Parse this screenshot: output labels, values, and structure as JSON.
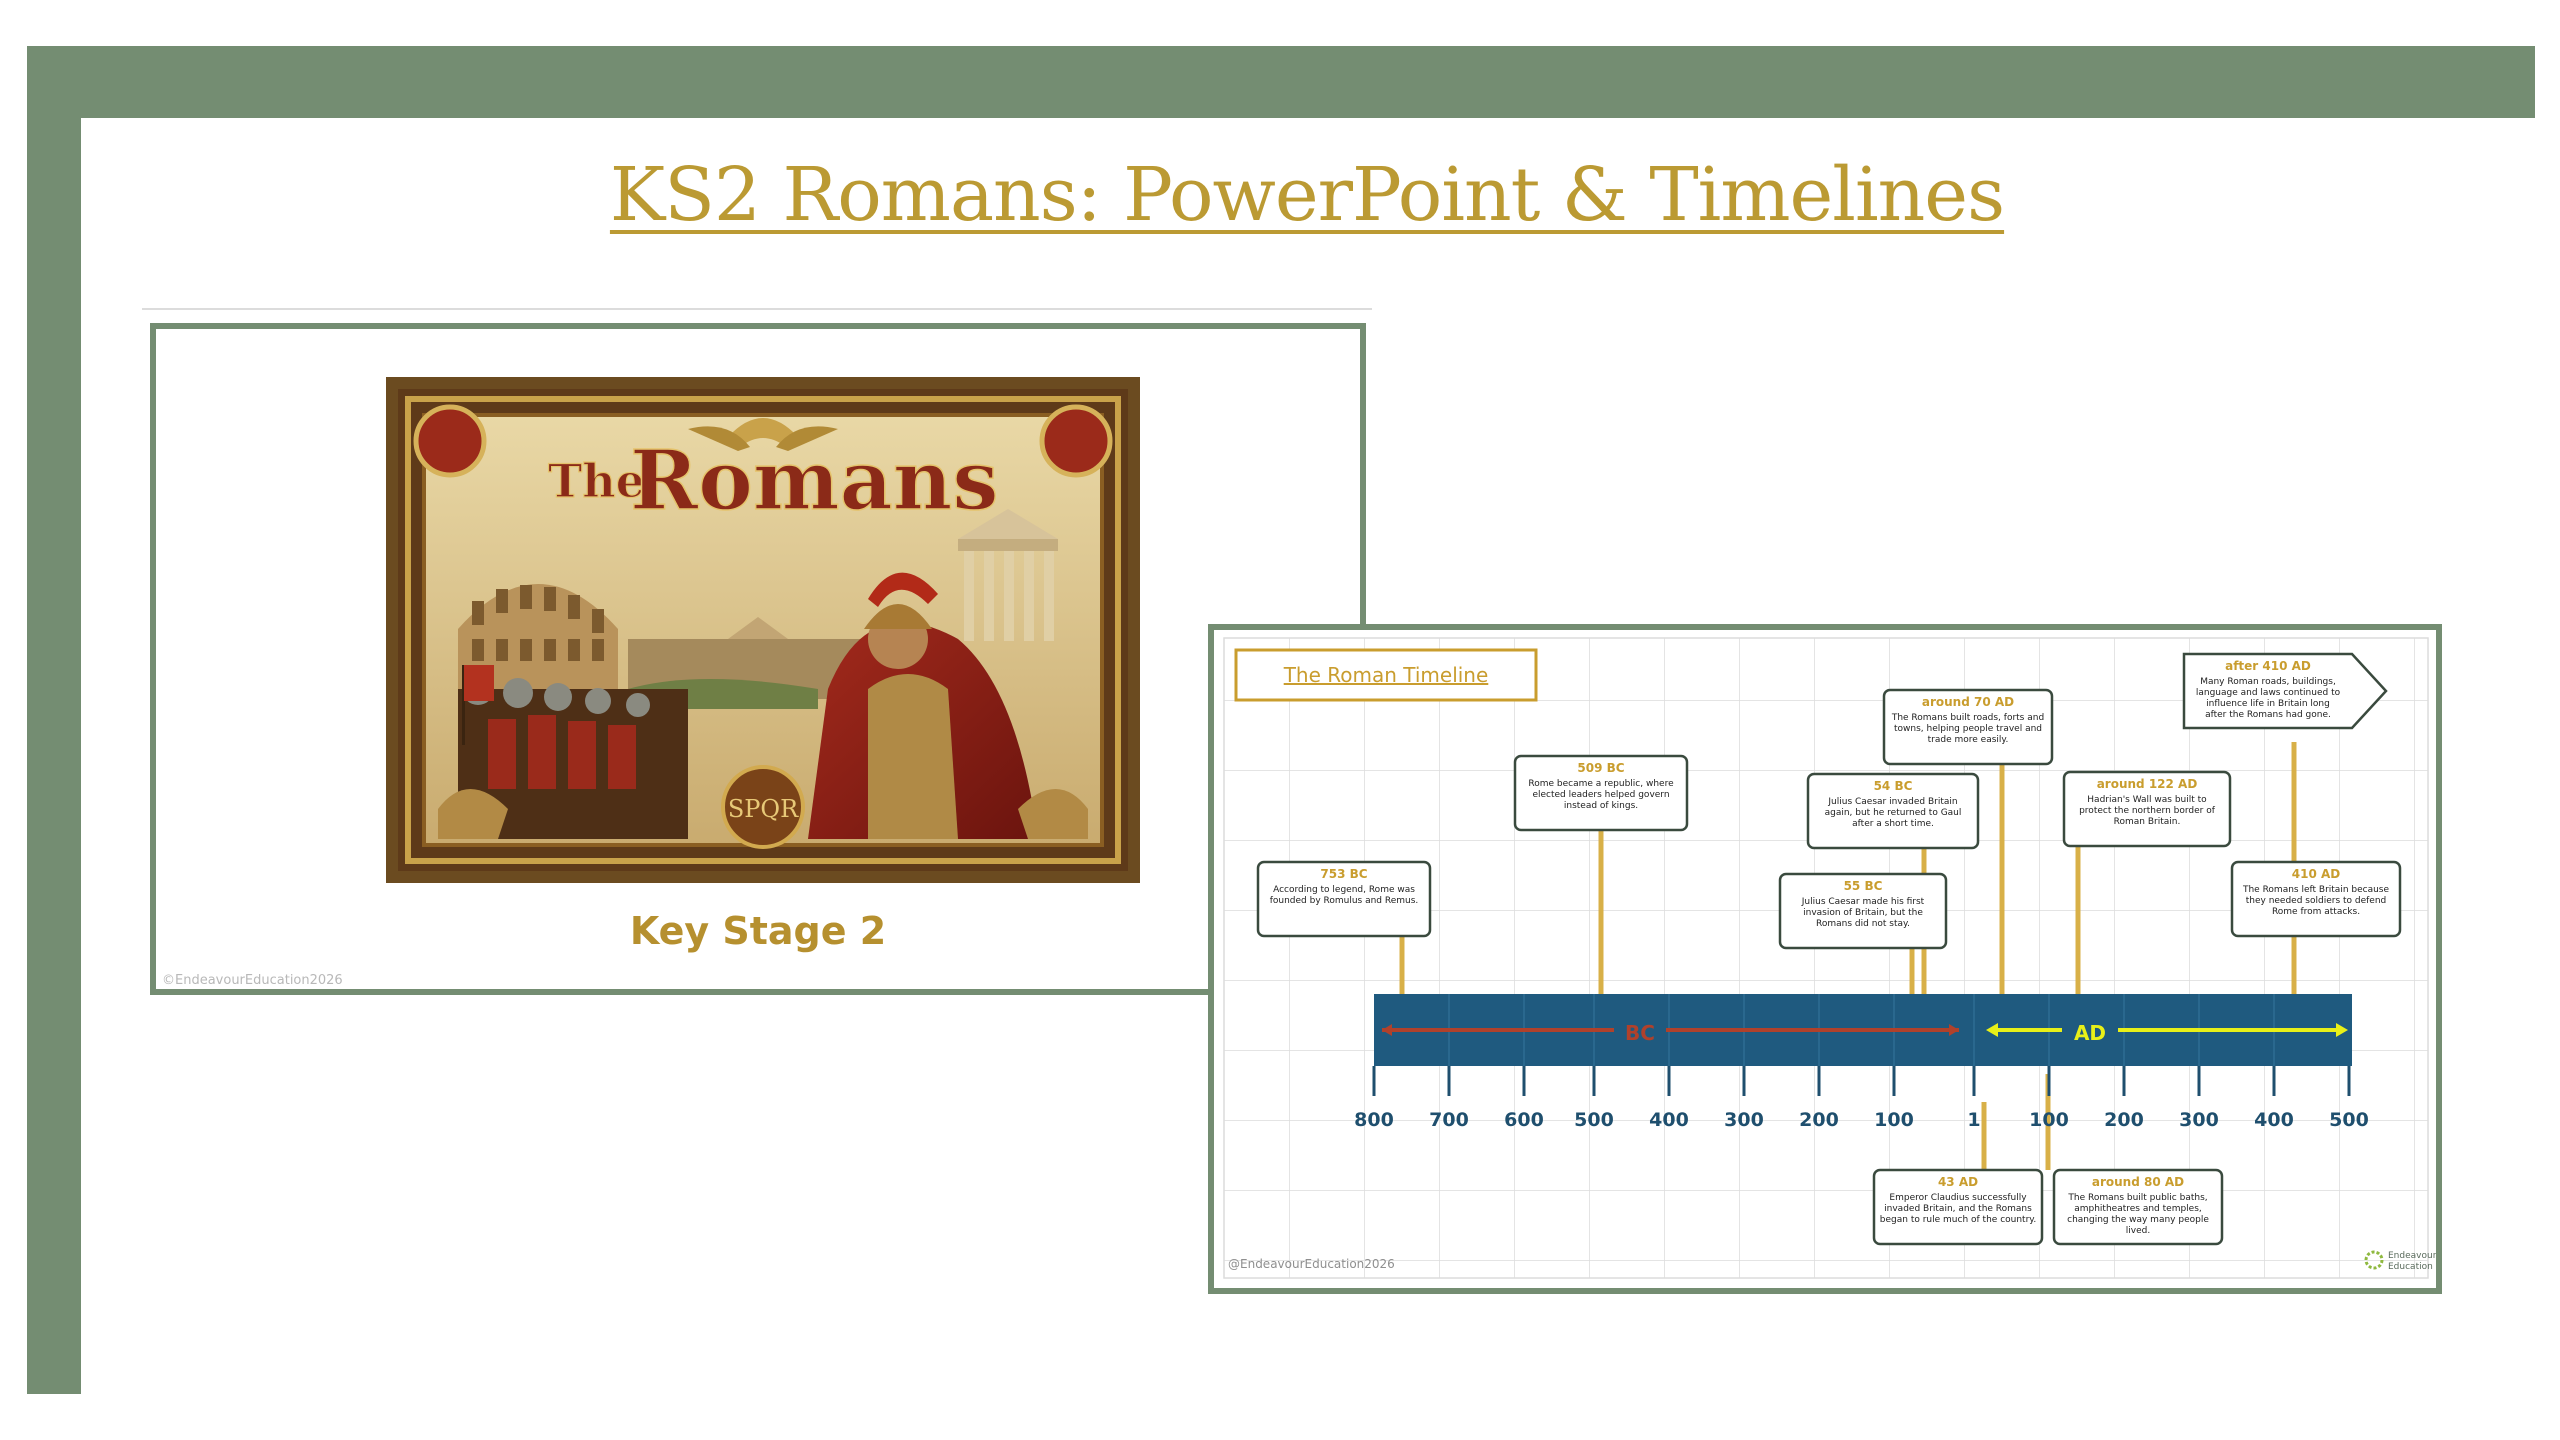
{
  "slide_title": "KS2 Romans: PowerPoint & Timelines",
  "cover_slide": {
    "poster_text_small": "The",
    "poster_text_large": "Romans",
    "seal_text": "SPQR",
    "subtitle": "Key Stage 2",
    "copyright": "©EndeavourEducation2026"
  },
  "timeline_slide": {
    "title": "The Roman Timeline",
    "band_bc": "BC",
    "band_ad": "AD",
    "ticks": [
      "800",
      "700",
      "600",
      "500",
      "400",
      "300",
      "200",
      "100",
      "1",
      "100",
      "200",
      "300",
      "400",
      "500"
    ],
    "events": [
      {
        "date": "753 BC",
        "text": "According to legend, Rome was founded by Romulus and Remus."
      },
      {
        "date": "509 BC",
        "text": "Rome became a republic, where elected leaders helped govern instead of kings."
      },
      {
        "date": "55 BC",
        "text": "Julius Caesar made his first invasion of Britain, but the Romans did not stay."
      },
      {
        "date": "54 BC",
        "text": "Julius Caesar invaded Britain again, but he returned to Gaul after a short time."
      },
      {
        "date": "around 70 AD",
        "text": "The Romans built roads, forts and towns, helping people travel and trade more easily."
      },
      {
        "date": "around 122 AD",
        "text": "Hadrian's Wall was built to protect the northern border of Roman Britain."
      },
      {
        "date": "after 410 AD",
        "text": "Many Roman roads, buildings, language and laws continued to influence life in Britain long after the Romans had gone."
      },
      {
        "date": "410 AD",
        "text": "The Romans left Britain because they needed soldiers to defend Rome from attacks."
      },
      {
        "date": "43 AD",
        "text": "Emperor Claudius successfully invaded Britain, and the Romans began to rule much of the country."
      },
      {
        "date": "around 80 AD",
        "text": "The Romans built public baths, amphitheatres and temples, changing the way many people lived."
      }
    ],
    "copyright": "@EndeavourEducation2026",
    "logo_line1": "Endeavour",
    "logo_line2": "Education"
  },
  "colors": {
    "frame": "#748d72",
    "title": "#bb9a33",
    "band": "#1f5a7f",
    "bc_arrow": "#b0412b",
    "ad_arrow": "#e8f018",
    "event_date": "#c99d2e",
    "tick_label": "#1f4f6e"
  }
}
